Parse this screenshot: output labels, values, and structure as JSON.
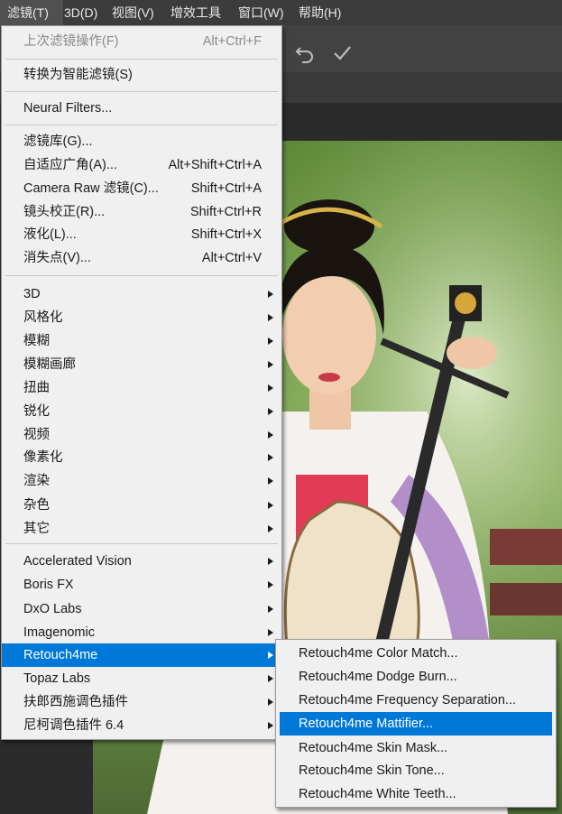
{
  "menubar": {
    "items": [
      "滤镜(T)",
      "3D(D)",
      "视图(V)",
      "增效工具",
      "窗口(W)",
      "帮助(H)"
    ]
  },
  "filter_menu": {
    "last_filter": {
      "label": "上次滤镜操作(F)",
      "shortcut": "Alt+Ctrl+F"
    },
    "smart_filters": {
      "label": "转换为智能滤镜(S)"
    },
    "neural_filters": {
      "label": "Neural Filters..."
    },
    "filter_gallery": {
      "label": "滤镜库(G)..."
    },
    "adaptive_wide_angle": {
      "label": "自适应广角(A)...",
      "shortcut": "Alt+Shift+Ctrl+A"
    },
    "camera_raw": {
      "label": "Camera Raw 滤镜(C)...",
      "shortcut": "Shift+Ctrl+A"
    },
    "lens_correction": {
      "label": "镜头校正(R)...",
      "shortcut": "Shift+Ctrl+R"
    },
    "liquify": {
      "label": "液化(L)...",
      "shortcut": "Shift+Ctrl+X"
    },
    "vanishing_point": {
      "label": "消失点(V)...",
      "shortcut": "Alt+Ctrl+V"
    },
    "groups": [
      "3D",
      "风格化",
      "模糊",
      "模糊画廊",
      "扭曲",
      "锐化",
      "视频",
      "像素化",
      "渲染",
      "杂色",
      "其它"
    ],
    "plugins": [
      "Accelerated Vision",
      "Boris FX",
      "DxO Labs",
      "Imagenomic",
      "Retouch4me",
      "Topaz Labs",
      "扶郎西施调色插件",
      "尼柯调色插件 6.4"
    ]
  },
  "retouch4me_submenu": {
    "items": [
      "Retouch4me Color Match...",
      "Retouch4me Dodge Burn...",
      "Retouch4me Frequency Separation...",
      "Retouch4me Mattifier...",
      "Retouch4me Skin Mask...",
      "Retouch4me Skin Tone...",
      "Retouch4me White Teeth..."
    ]
  },
  "colors": {
    "highlight": "#0078d7",
    "menu_bg": "#f0f0f0",
    "menubar_bg": "#3c3c3c"
  }
}
